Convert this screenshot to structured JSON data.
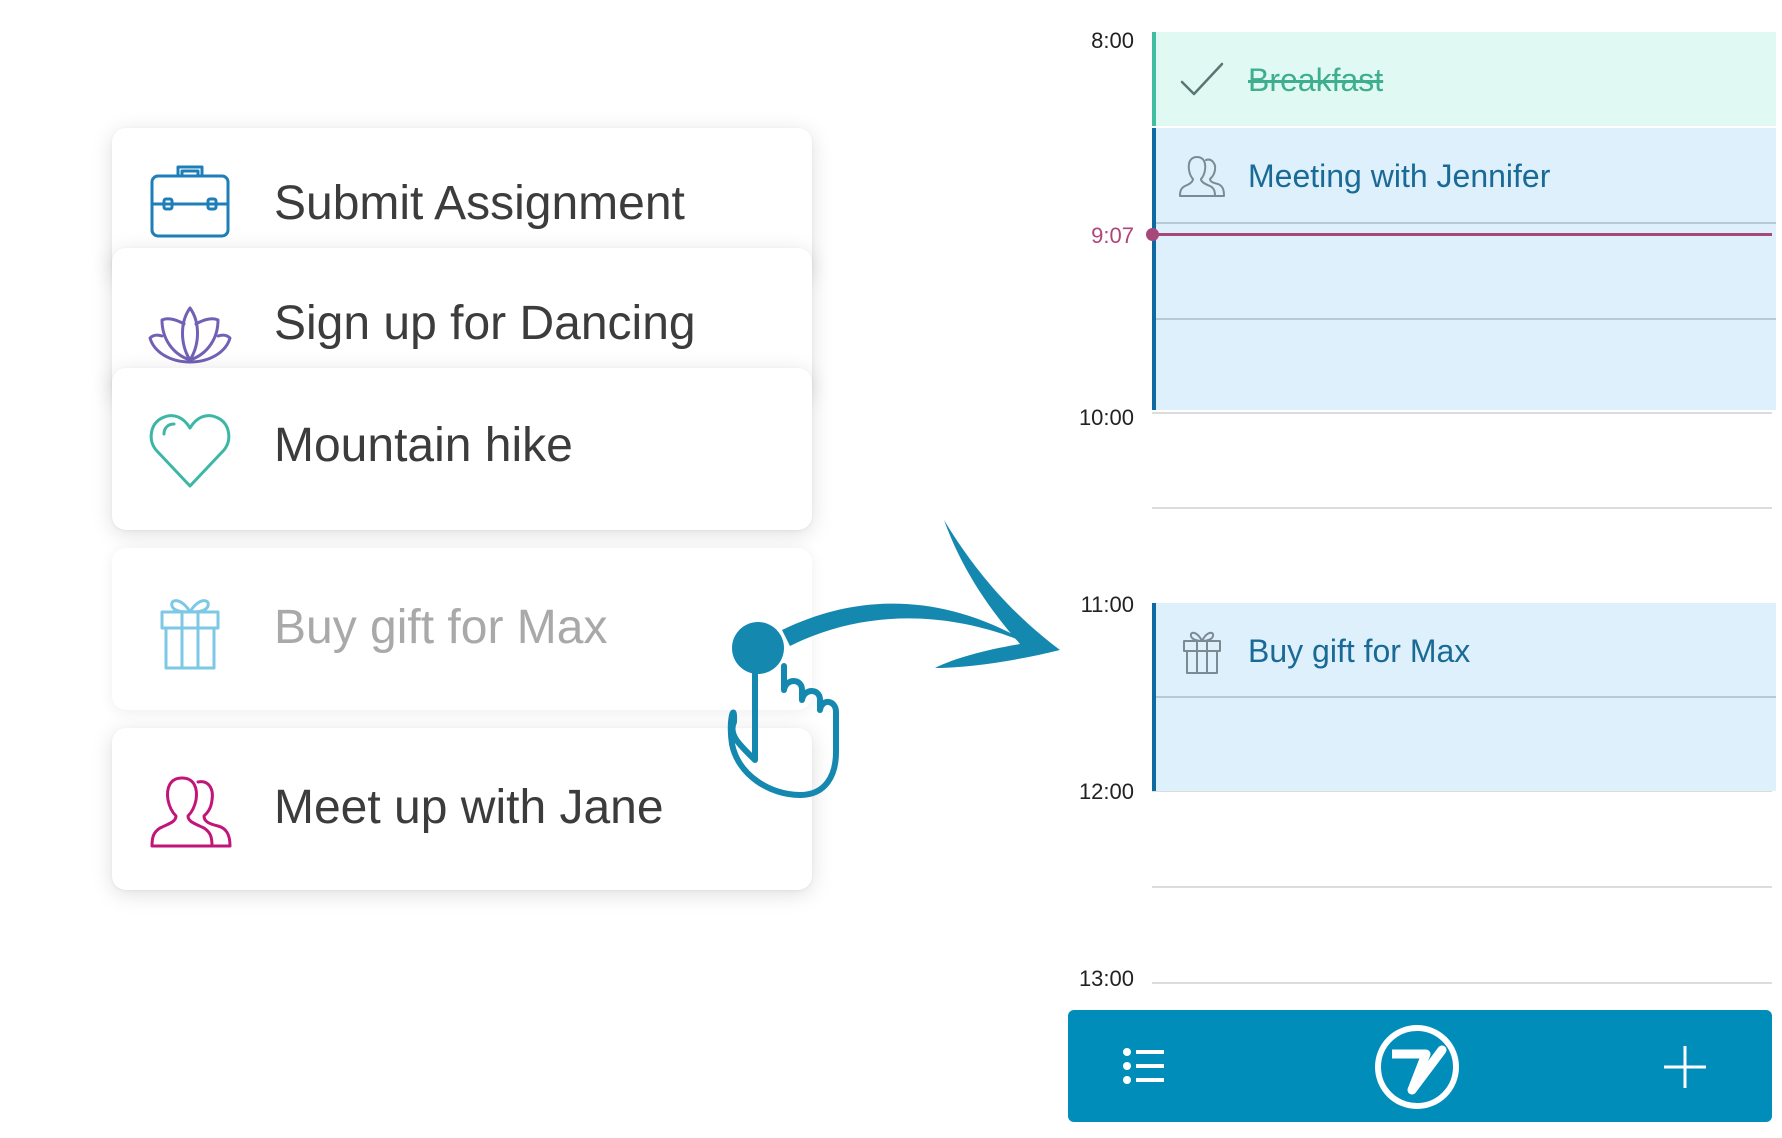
{
  "task_list": {
    "items": [
      {
        "label": "Submit Assignment",
        "icon": "briefcase-icon",
        "icon_color": "#1e7fb8"
      },
      {
        "label": "Sign up for Dancing",
        "icon": "lotus-icon",
        "icon_color": "#7160b5"
      },
      {
        "label": "Mountain hike",
        "icon": "heart-icon",
        "icon_color": "#3cb7a6"
      },
      {
        "label": "Buy gift for Max",
        "icon": "gift-icon",
        "icon_color": "#7cc8e6",
        "state": "dragging"
      },
      {
        "label": "Meet up with Jane",
        "icon": "people-icon",
        "icon_color": "#c2157a"
      }
    ]
  },
  "calendar": {
    "hours": [
      "8:00",
      "10:00",
      "11:00",
      "12:00",
      "13:00"
    ],
    "current_time": "9:07",
    "events": [
      {
        "title": "Breakfast",
        "icon": "checkmark-icon",
        "status": "completed",
        "color": "#3fbea1"
      },
      {
        "title": "Meeting with Jennifer",
        "icon": "people-icon",
        "color": "#0e6aa1"
      },
      {
        "title": "Buy gift for Max",
        "icon": "gift-icon",
        "color": "#0e6aa1"
      }
    ]
  },
  "bottom_bar": {
    "color": "#008dba",
    "buttons": [
      {
        "icon": "list-icon"
      },
      {
        "icon": "app-logo-icon"
      },
      {
        "icon": "plus-icon"
      }
    ]
  },
  "gesture": {
    "icon": "tap-hand-icon",
    "arrow": "drag-arrow-icon",
    "color": "#1588b0"
  },
  "colors": {
    "now_indicator": "#a7487a",
    "event_blue": "#ddf0fc",
    "event_done": "#e0faf3"
  }
}
